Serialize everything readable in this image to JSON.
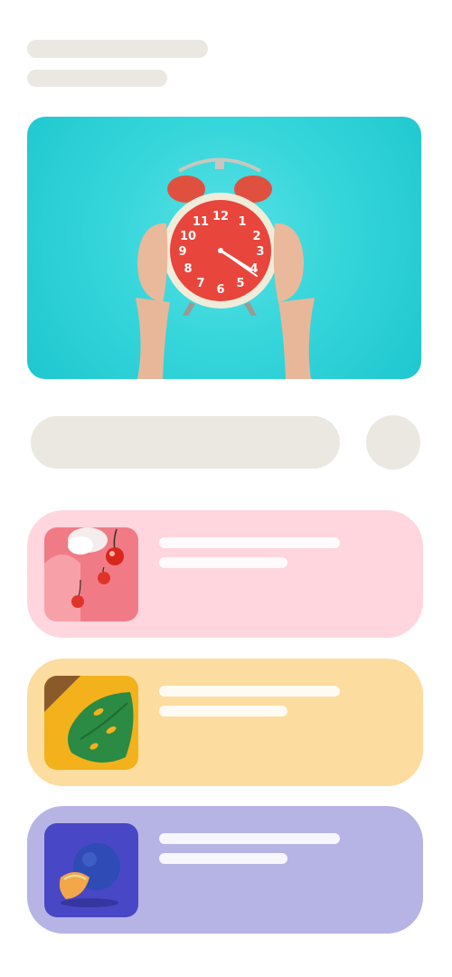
{
  "theme": {
    "background": "#ffffff",
    "skeleton": "#ebe8e2",
    "hero_background": "#36d6db"
  },
  "header": {
    "skeleton_lines": 2
  },
  "hero": {
    "image": "alarm-clock-held-up",
    "clock_face_color": "#e8453c"
  },
  "search_row": {
    "input": "pill-input",
    "action": "circle-button"
  },
  "cards": [
    {
      "color": "#ffd6de",
      "thumbnail": "cherries-cream",
      "thumb_color": "#f07b86"
    },
    {
      "color": "#fcdc9f",
      "thumbnail": "monstera-leaf",
      "thumb_color": "#f3b21b"
    },
    {
      "color": "#b5b4e4",
      "thumbnail": "melon-slice",
      "thumb_color": "#4848c6"
    }
  ]
}
